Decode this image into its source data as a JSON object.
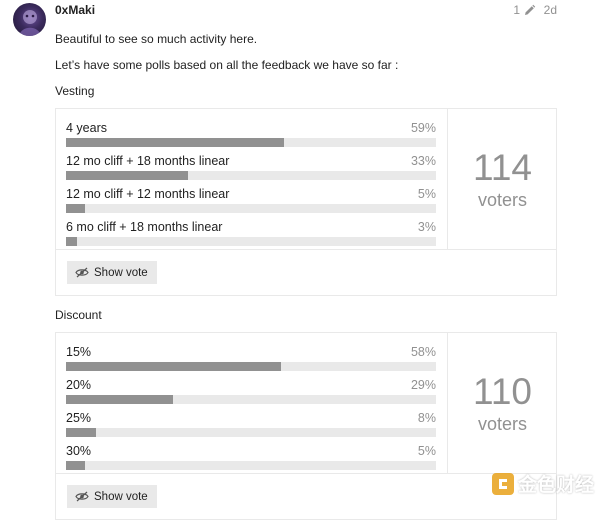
{
  "post": {
    "username": "0xMaki",
    "edit_count": "1",
    "date": "2d",
    "paragraphs": [
      "Beautiful to see so much activity here.",
      "Let’s have some polls based on all the feedback we have so far :"
    ]
  },
  "polls": [
    {
      "title": "Vesting",
      "voters": "114",
      "voters_label": "voters",
      "button_label": "Show vote",
      "options": [
        {
          "label": "4 years",
          "percent": "59%"
        },
        {
          "label": "12 mo cliff + 18 months linear",
          "percent": "33%"
        },
        {
          "label": "12 mo cliff + 12 months linear",
          "percent": "5%"
        },
        {
          "label": "6 mo cliff + 18 months linear",
          "percent": "3%"
        }
      ]
    },
    {
      "title": "Discount",
      "voters": "110",
      "voters_label": "voters",
      "button_label": "Show vote",
      "options": [
        {
          "label": "15%",
          "percent": "58%"
        },
        {
          "label": "20%",
          "percent": "29%"
        },
        {
          "label": "25%",
          "percent": "8%"
        },
        {
          "label": "30%",
          "percent": "5%"
        }
      ]
    }
  ],
  "watermark": {
    "text": "金色财经"
  },
  "colors": {
    "bar_fill": "#919191",
    "bar_track": "#e9e9e9",
    "muted": "#919191",
    "border": "#e9e9e9"
  }
}
